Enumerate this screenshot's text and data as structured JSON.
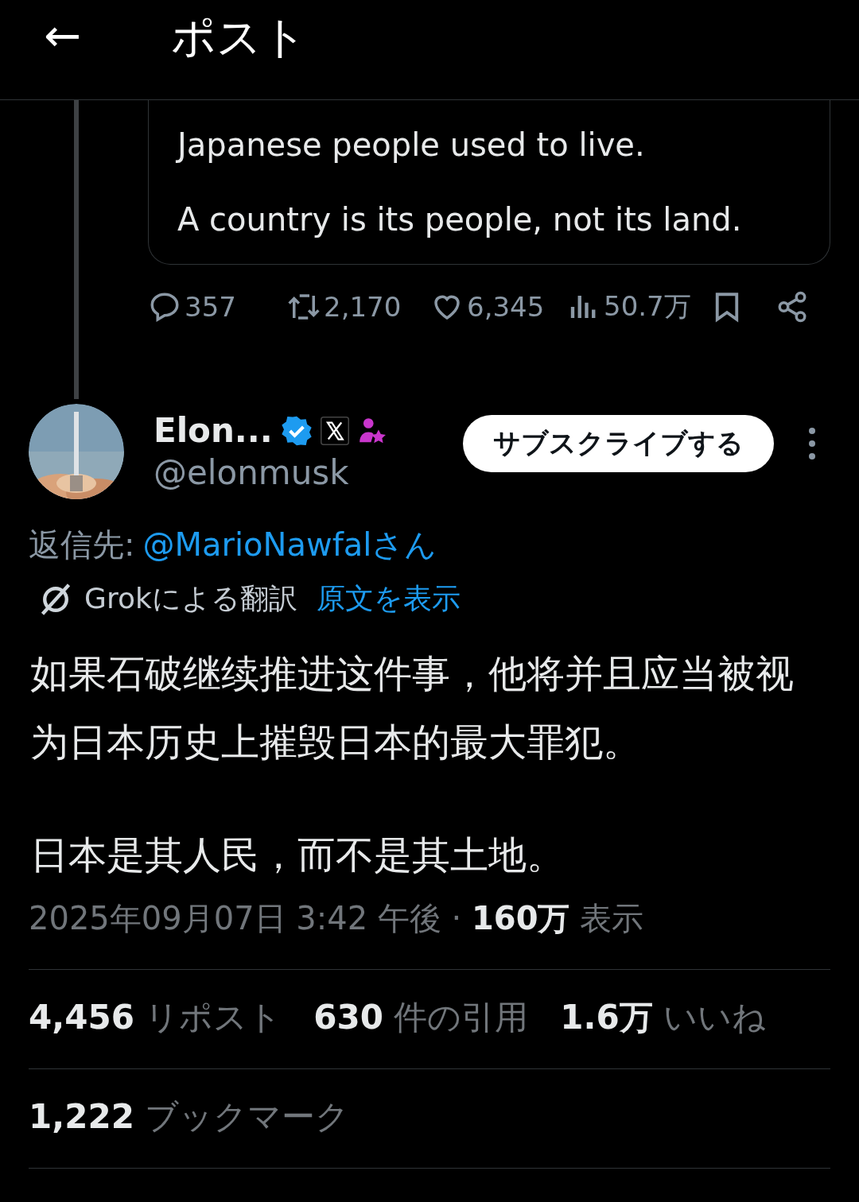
{
  "header": {
    "back_icon": "←",
    "title": "ポスト"
  },
  "quoted_post": {
    "paragraphs": [
      "Japanese people used to live.",
      "A country is its people, not its land."
    ]
  },
  "actions": [
    {
      "kind": "reply",
      "count": "357"
    },
    {
      "kind": "repost",
      "count": "2,170"
    },
    {
      "kind": "like",
      "count": "6,345"
    },
    {
      "kind": "views",
      "count": "50.7万"
    },
    {
      "kind": "bookmark"
    },
    {
      "kind": "share"
    }
  ],
  "author": {
    "name": "Elon...",
    "handle": "@elonmusk",
    "verified": true,
    "subscribe_button": "サブスクライブする"
  },
  "reply_to": {
    "label": "返信先:",
    "handle": "@MarioNawfalさん"
  },
  "translation": {
    "label": "Grokによる翻訳",
    "link": "原文を表示"
  },
  "body": [
    "如果石破继续推进这件事，他将并且应当被视为日本历史上摧毁日本的最大罪犯。",
    "日本是其人民，而不是其土地。"
  ],
  "timestamp": "2025年09月07日 3:42 午後 · **160万** 表示",
  "stats": [
    "**4,456** リポスト",
    "**630** 件の引用",
    "**1.6万** いいね"
  ],
  "bookmarks": "**1,222** ブックマーク"
}
